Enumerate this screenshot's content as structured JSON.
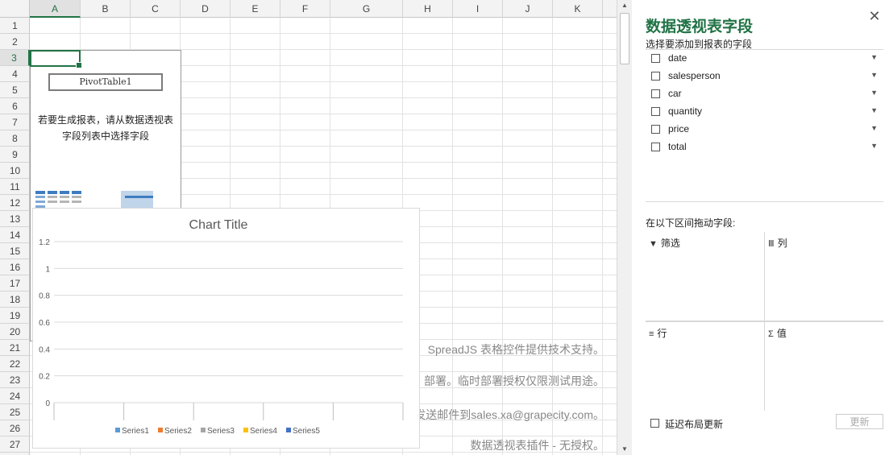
{
  "sheet": {
    "columns": [
      "A",
      "B",
      "C",
      "D",
      "E",
      "F",
      "G",
      "H",
      "I",
      "J",
      "K"
    ],
    "rows": [
      "1",
      "2",
      "3",
      "4",
      "5",
      "6",
      "7",
      "8",
      "9",
      "10",
      "11",
      "12",
      "13",
      "14",
      "15",
      "16",
      "17",
      "18",
      "19",
      "20",
      "21",
      "22",
      "23",
      "24",
      "25",
      "26",
      "27"
    ],
    "active_column": "A",
    "active_row": "3"
  },
  "pivot_placeholder": {
    "name": "PivotTable1",
    "hint_line1": "若要生成报表，请从数据透视表",
    "hint_line2": "字段列表中选择字段"
  },
  "chart_data": {
    "type": "bar",
    "title": "Chart Title",
    "categories": [
      "",
      "",
      "",
      "",
      ""
    ],
    "series": [
      {
        "name": "Series1",
        "values": [],
        "color": "#5b9bd5"
      },
      {
        "name": "Series2",
        "values": [],
        "color": "#ed7d31"
      },
      {
        "name": "Series3",
        "values": [],
        "color": "#a5a5a5"
      },
      {
        "name": "Series4",
        "values": [],
        "color": "#ffc000"
      },
      {
        "name": "Series5",
        "values": [],
        "color": "#4472c4"
      }
    ],
    "yticks": [
      "0",
      "0.2",
      "0.4",
      "0.6",
      "0.8",
      "1",
      "1.2"
    ],
    "ylim": [
      0,
      1.2
    ],
    "grid": true,
    "legend": "bottom"
  },
  "watermark": {
    "line1": "SpreadJS 表格控件提供技术支持。",
    "line2": "部署。临时部署授权仅限测试用途。",
    "line3": "发送邮件到sales.xa@grapecity.com。",
    "line4": "数据透视表插件 - 无授权。"
  },
  "panel": {
    "title": "数据透视表字段",
    "close": "✕",
    "subtitle": "选择要添加到报表的字段",
    "fields": [
      "date",
      "salesperson",
      "car",
      "quantity",
      "price",
      "total"
    ],
    "drag_hint": "在以下区间拖动字段:",
    "areas": {
      "filter": "筛选",
      "columns": "列",
      "rows": "行",
      "values": "值"
    },
    "defer_label": "延迟布局更新",
    "update_label": "更新"
  },
  "colors": {
    "accent": "#217346"
  }
}
